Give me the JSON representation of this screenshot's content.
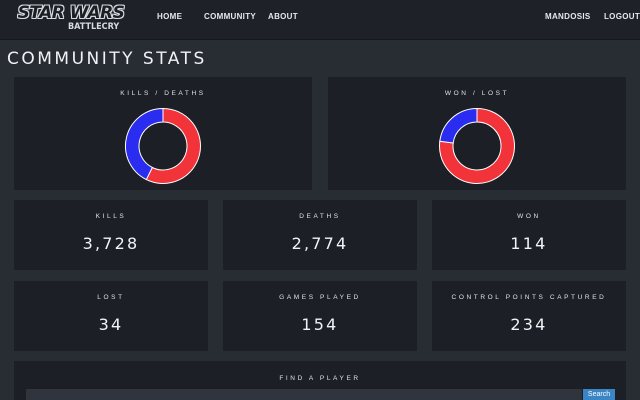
{
  "nav": {
    "logo_top": "STAR WARS",
    "logo_bottom": "BATTLECRY",
    "home": "HOME",
    "community": "COMMUNITY",
    "about": "ABOUT",
    "user": "MANDOSIS",
    "logout": "LOGOUT"
  },
  "page_title": "COMMUNITY STATS",
  "charts": {
    "kills_deaths": {
      "label": "KILLS / DEATHS",
      "segments": [
        {
          "name": "Kills",
          "value": 3728,
          "color": "#f2343a"
        },
        {
          "name": "Deaths",
          "value": 2774,
          "color": "#2a2df0"
        }
      ]
    },
    "won_lost": {
      "label": "WON / LOST",
      "segments": [
        {
          "name": "Won",
          "value": 114,
          "color": "#f2343a"
        },
        {
          "name": "Lost",
          "value": 34,
          "color": "#2a2df0"
        }
      ]
    }
  },
  "stats": {
    "kills": {
      "label": "KILLS",
      "value": "3,728"
    },
    "deaths": {
      "label": "DEATHS",
      "value": "2,774"
    },
    "won": {
      "label": "WON",
      "value": "114"
    },
    "lost": {
      "label": "LOST",
      "value": "34"
    },
    "games_played": {
      "label": "GAMES PLAYED",
      "value": "154"
    },
    "control_points": {
      "label": "CONTROL POINTS CAPTURED",
      "value": "234"
    }
  },
  "find_player": {
    "label": "FIND A PLAYER",
    "input_value": "",
    "button": "Search"
  }
}
